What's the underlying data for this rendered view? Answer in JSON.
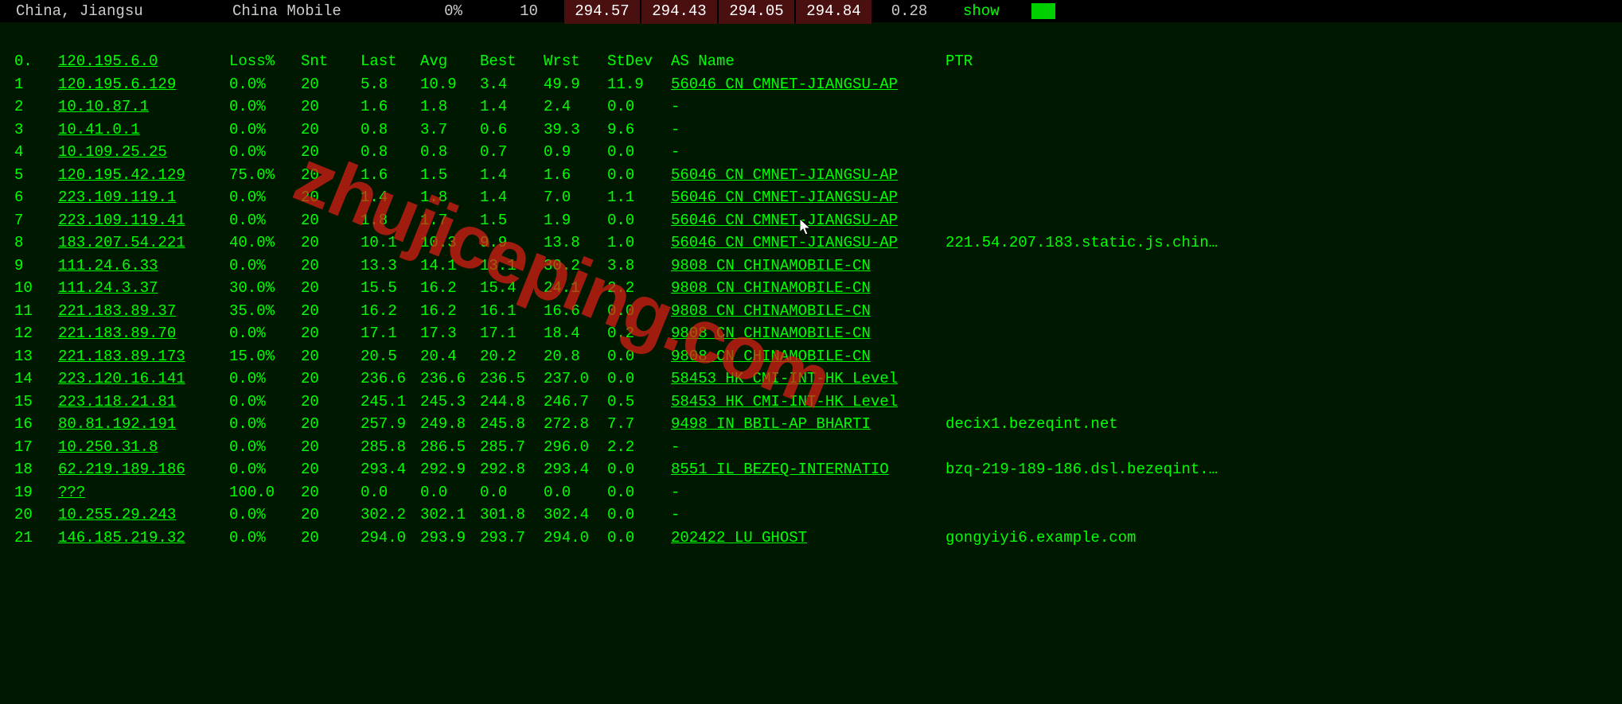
{
  "topbar": {
    "location": "China, Jiangsu",
    "isp": "China Mobile",
    "pct": "0%",
    "count": "10",
    "pings": [
      "294.57",
      "294.43",
      "294.05",
      "294.84"
    ],
    "stdev": "0.28",
    "show": "show"
  },
  "headers": {
    "hop": "0.",
    "ip": "120.195.6.0",
    "loss": "Loss%",
    "snt": "Snt",
    "last": "Last",
    "avg": "Avg",
    "best": "Best",
    "wrst": "Wrst",
    "stdev": "StDev",
    "as": "AS Name",
    "ptr": "PTR"
  },
  "rows": [
    {
      "hop": "1",
      "ip": "120.195.6.129",
      "loss": "0.0%",
      "snt": "20",
      "last": "5.8",
      "avg": "10.9",
      "best": "3.4",
      "wrst": "49.9",
      "stdev": "11.9",
      "as": "56046 CN CMNET-JIANGSU-AP",
      "as_ul": true,
      "ptr": ""
    },
    {
      "hop": "2",
      "ip": "10.10.87.1",
      "loss": "0.0%",
      "snt": "20",
      "last": "1.6",
      "avg": "1.8",
      "best": "1.4",
      "wrst": "2.4",
      "stdev": "0.0",
      "as": "-",
      "as_ul": false,
      "ptr": ""
    },
    {
      "hop": "3",
      "ip": "10.41.0.1",
      "loss": "0.0%",
      "snt": "20",
      "last": "0.8",
      "avg": "3.7",
      "best": "0.6",
      "wrst": "39.3",
      "stdev": "9.6",
      "as": "-",
      "as_ul": false,
      "ptr": ""
    },
    {
      "hop": "4",
      "ip": "10.109.25.25",
      "loss": "0.0%",
      "snt": "20",
      "last": "0.8",
      "avg": "0.8",
      "best": "0.7",
      "wrst": "0.9",
      "stdev": "0.0",
      "as": "-",
      "as_ul": false,
      "ptr": ""
    },
    {
      "hop": "5",
      "ip": "120.195.42.129",
      "loss": "75.0%",
      "snt": "20",
      "last": "1.6",
      "avg": "1.5",
      "best": "1.4",
      "wrst": "1.6",
      "stdev": "0.0",
      "as": "56046 CN CMNET-JIANGSU-AP",
      "as_ul": true,
      "ptr": ""
    },
    {
      "hop": "6",
      "ip": "223.109.119.1",
      "loss": "0.0%",
      "snt": "20",
      "last": "1.4",
      "avg": "1.8",
      "best": "1.4",
      "wrst": "7.0",
      "stdev": "1.1",
      "as": "56046 CN CMNET-JIANGSU-AP",
      "as_ul": true,
      "ptr": ""
    },
    {
      "hop": "7",
      "ip": "223.109.119.41",
      "loss": "0.0%",
      "snt": "20",
      "last": "1.8",
      "avg": "1.7",
      "best": "1.5",
      "wrst": "1.9",
      "stdev": "0.0",
      "as": "56046 CN CMNET-JIANGSU-AP",
      "as_ul": true,
      "ptr": ""
    },
    {
      "hop": "8",
      "ip": "183.207.54.221",
      "loss": "40.0%",
      "snt": "20",
      "last": "10.1",
      "avg": "10.3",
      "best": "9.9",
      "wrst": "13.8",
      "stdev": "1.0",
      "as": "56046 CN CMNET-JIANGSU-AP",
      "as_ul": true,
      "ptr": "221.54.207.183.static.js.chin…"
    },
    {
      "hop": "9",
      "ip": "111.24.6.33",
      "loss": "0.0%",
      "snt": "20",
      "last": "13.3",
      "avg": "14.1",
      "best": "13.1",
      "wrst": "30.2",
      "stdev": "3.8",
      "as": "9808  CN CHINAMOBILE-CN",
      "as_ul": true,
      "ptr": ""
    },
    {
      "hop": "10",
      "ip": "111.24.3.37",
      "loss": "30.0%",
      "snt": "20",
      "last": "15.5",
      "avg": "16.2",
      "best": "15.4",
      "wrst": "24.1",
      "stdev": "2.2",
      "as": "9808  CN CHINAMOBILE-CN",
      "as_ul": true,
      "ptr": ""
    },
    {
      "hop": "11",
      "ip": "221.183.89.37",
      "loss": "35.0%",
      "snt": "20",
      "last": "16.2",
      "avg": "16.2",
      "best": "16.1",
      "wrst": "16.6",
      "stdev": "0.0",
      "as": "9808  CN CHINAMOBILE-CN",
      "as_ul": true,
      "ptr": ""
    },
    {
      "hop": "12",
      "ip": "221.183.89.70",
      "loss": "0.0%",
      "snt": "20",
      "last": "17.1",
      "avg": "17.3",
      "best": "17.1",
      "wrst": "18.4",
      "stdev": "0.2",
      "as": "9808  CN CHINAMOBILE-CN",
      "as_ul": true,
      "ptr": ""
    },
    {
      "hop": "13",
      "ip": "221.183.89.173",
      "loss": "15.0%",
      "snt": "20",
      "last": "20.5",
      "avg": "20.4",
      "best": "20.2",
      "wrst": "20.8",
      "stdev": "0.0",
      "as": "9808  CN CHINAMOBILE-CN",
      "as_ul": true,
      "ptr": ""
    },
    {
      "hop": "14",
      "ip": "223.120.16.141",
      "loss": "0.0%",
      "snt": "20",
      "last": "236.6",
      "avg": "236.6",
      "best": "236.5",
      "wrst": "237.0",
      "stdev": "0.0",
      "as": "58453 HK CMI-INT-HK Level",
      "as_ul": true,
      "ptr": ""
    },
    {
      "hop": "15",
      "ip": "223.118.21.81",
      "loss": "0.0%",
      "snt": "20",
      "last": "245.1",
      "avg": "245.3",
      "best": "244.8",
      "wrst": "246.7",
      "stdev": "0.5",
      "as": "58453 HK CMI-INT-HK Level",
      "as_ul": true,
      "ptr": ""
    },
    {
      "hop": "16",
      "ip": "80.81.192.191",
      "loss": "0.0%",
      "snt": "20",
      "last": "257.9",
      "avg": "249.8",
      "best": "245.8",
      "wrst": "272.8",
      "stdev": "7.7",
      "as": "9498  IN BBIL-AP BHARTI",
      "as_ul": true,
      "ptr": "decix1.bezeqint.net"
    },
    {
      "hop": "17",
      "ip": "10.250.31.8",
      "loss": "0.0%",
      "snt": "20",
      "last": "285.8",
      "avg": "286.5",
      "best": "285.7",
      "wrst": "296.0",
      "stdev": "2.2",
      "as": "-",
      "as_ul": false,
      "ptr": ""
    },
    {
      "hop": "18",
      "ip": "62.219.189.186",
      "loss": "0.0%",
      "snt": "20",
      "last": "293.4",
      "avg": "292.9",
      "best": "292.8",
      "wrst": "293.4",
      "stdev": "0.0",
      "as": "8551  IL BEZEQ-INTERNATIO",
      "as_ul": true,
      "ptr": "bzq-219-189-186.dsl.bezeqint.…"
    },
    {
      "hop": "19",
      "ip": "???",
      "loss": "100.0",
      "snt": "20",
      "last": "0.0",
      "avg": "0.0",
      "best": "0.0",
      "wrst": "0.0",
      "stdev": "0.0",
      "as": "-",
      "as_ul": false,
      "ptr": ""
    },
    {
      "hop": "20",
      "ip": "10.255.29.243",
      "loss": "0.0%",
      "snt": "20",
      "last": "302.2",
      "avg": "302.1",
      "best": "301.8",
      "wrst": "302.4",
      "stdev": "0.0",
      "as": "-",
      "as_ul": false,
      "ptr": ""
    },
    {
      "hop": "21",
      "ip": "146.185.219.32",
      "loss": "0.0%",
      "snt": "20",
      "last": "294.0",
      "avg": "293.9",
      "best": "293.7",
      "wrst": "294.0",
      "stdev": "0.0",
      "as": "202422 LU GHOST",
      "as_ul": true,
      "ptr": "gongyiyi6.example.com"
    }
  ],
  "watermark": "zhujiceping.com"
}
